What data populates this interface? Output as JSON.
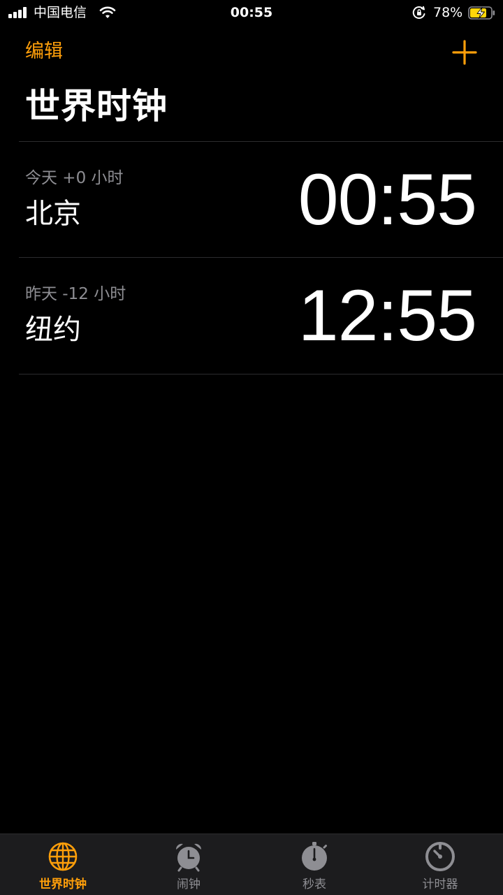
{
  "status_bar": {
    "carrier": "中国电信",
    "time": "00:55",
    "battery_percent": "78%",
    "icons": [
      "signal-icon",
      "wifi-icon",
      "orientation-lock-icon",
      "battery-charging-icon"
    ]
  },
  "header": {
    "edit_label": "编辑",
    "add_icon": "plus-icon",
    "title": "世界时钟"
  },
  "clocks": [
    {
      "offset": "今天 +0 小时",
      "city": "北京",
      "time": "00:55"
    },
    {
      "offset": "昨天 -12 小时",
      "city": "纽约",
      "time": "12:55"
    }
  ],
  "tabs": [
    {
      "label": "世界时钟",
      "icon": "globe-icon",
      "active": true
    },
    {
      "label": "闹钟",
      "icon": "alarm-clock-icon",
      "active": false
    },
    {
      "label": "秒表",
      "icon": "stopwatch-icon",
      "active": false
    },
    {
      "label": "计时器",
      "icon": "timer-icon",
      "active": false
    }
  ],
  "colors": {
    "accent": "#ff9f0a",
    "background": "#000000",
    "secondary_text": "#8e8e93",
    "tab_bar": "#1c1c1e"
  }
}
